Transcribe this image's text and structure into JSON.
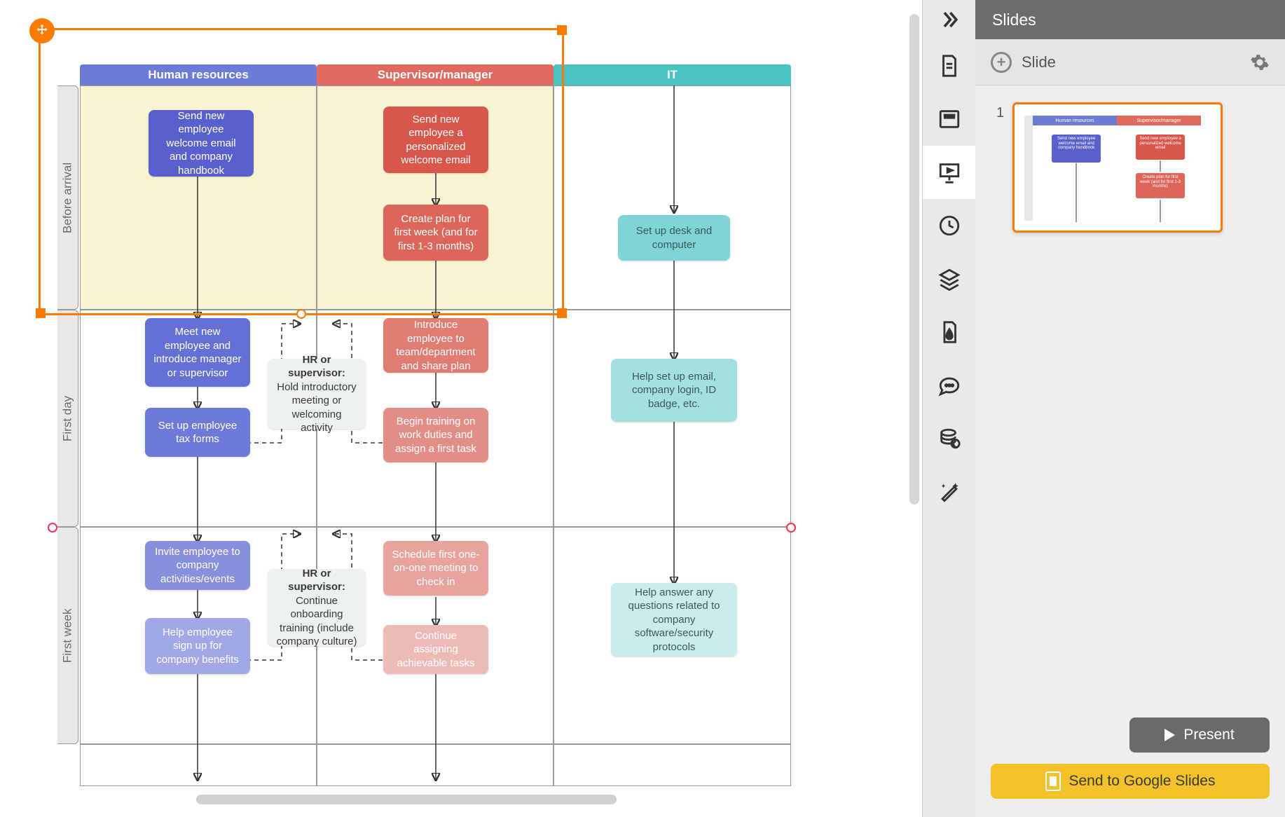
{
  "panel": {
    "title": "Slides",
    "add_slide": "Slide",
    "thumb_number": "1",
    "present_label": "Present",
    "google_label": "Send to Google Slides"
  },
  "columns": {
    "hr": "Human resources",
    "sm": "Supervisor/manager",
    "it": "IT"
  },
  "rows": {
    "ba": "Before arrival",
    "fd": "First day",
    "fw": "First week"
  },
  "nodes": {
    "hr_ba": "Send new employee welcome email and company handbook",
    "sm_ba1": "Send new employee a personalized welcome email",
    "sm_ba2": "Create plan for first week (and for first 1-3 months)",
    "it_ba": "Set up desk and computer",
    "hr_fd1": "Meet new employee and introduce manager or supervisor",
    "hr_fd2": "Set up employee tax forms",
    "gray_fd_title": "HR or supervisor:",
    "gray_fd_body": " Hold introductory meeting or welcoming activity",
    "sm_fd1": "Introduce employee to team/department and share plan",
    "sm_fd2": "Begin training on work duties and assign a first task",
    "it_fd": "Help set up email, company login, ID badge, etc.",
    "hr_fw1": "Invite employee to company activities/events",
    "hr_fw2": "Help employee sign up for company benefits",
    "gray_fw_title": "HR or supervisor:",
    "gray_fw_body": " Continue onboarding training (include company culture)",
    "sm_fw1": "Schedule first one-on-one meeting to check in",
    "sm_fw2": "Continue assigning achievable tasks",
    "it_fw": "Help answer any questions related to company software/security protocols"
  },
  "thumb": {
    "hr": "Human resources",
    "sm": "Supervisor/manager",
    "n1": "Send new employee welcome email and company handbook",
    "n2": "Send new employee a personalized welcome email",
    "n3": "Create plan for first week (and for first 1-3 months)"
  }
}
